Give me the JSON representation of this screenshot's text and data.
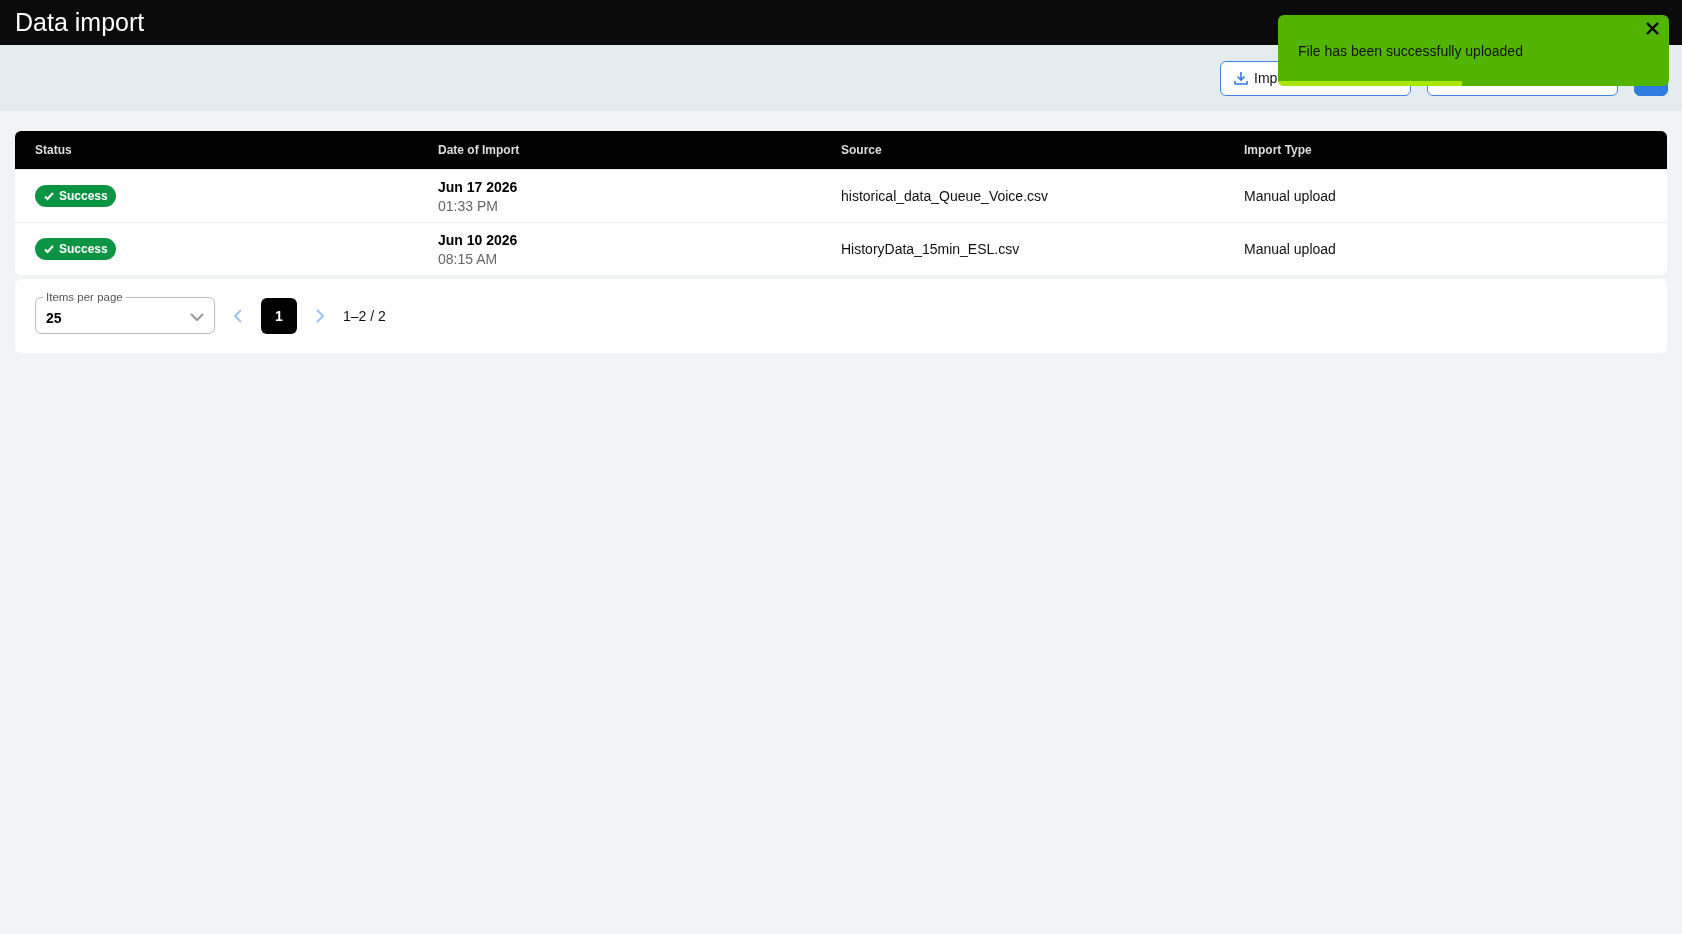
{
  "header": {
    "title": "Data import"
  },
  "toolbar": {
    "buttons": [
      {
        "kind": "import",
        "label": "Imp"
      },
      {
        "kind": "outline"
      },
      {
        "kind": "primary"
      }
    ]
  },
  "table": {
    "columns": [
      "Status",
      "Date of Import",
      "Source",
      "Import Type"
    ],
    "rows": [
      {
        "status": "Success",
        "date": "Jun 17 2026",
        "time": "01:33 PM",
        "source": "historical_data_Queue_Voice.csv",
        "import_type": "Manual upload"
      },
      {
        "status": "Success",
        "date": "Jun 10 2026",
        "time": "08:15 AM",
        "source": "HistoryData_15min_ESL.csv",
        "import_type": "Manual upload"
      }
    ]
  },
  "pagination": {
    "items_per_page_label": "Items per page",
    "items_per_page": "25",
    "pages": [
      {
        "label": "1",
        "selected": true
      }
    ],
    "range": "1–2 / 2"
  },
  "toast": {
    "message": "File has been successfully uploaded",
    "level": 0.47
  }
}
